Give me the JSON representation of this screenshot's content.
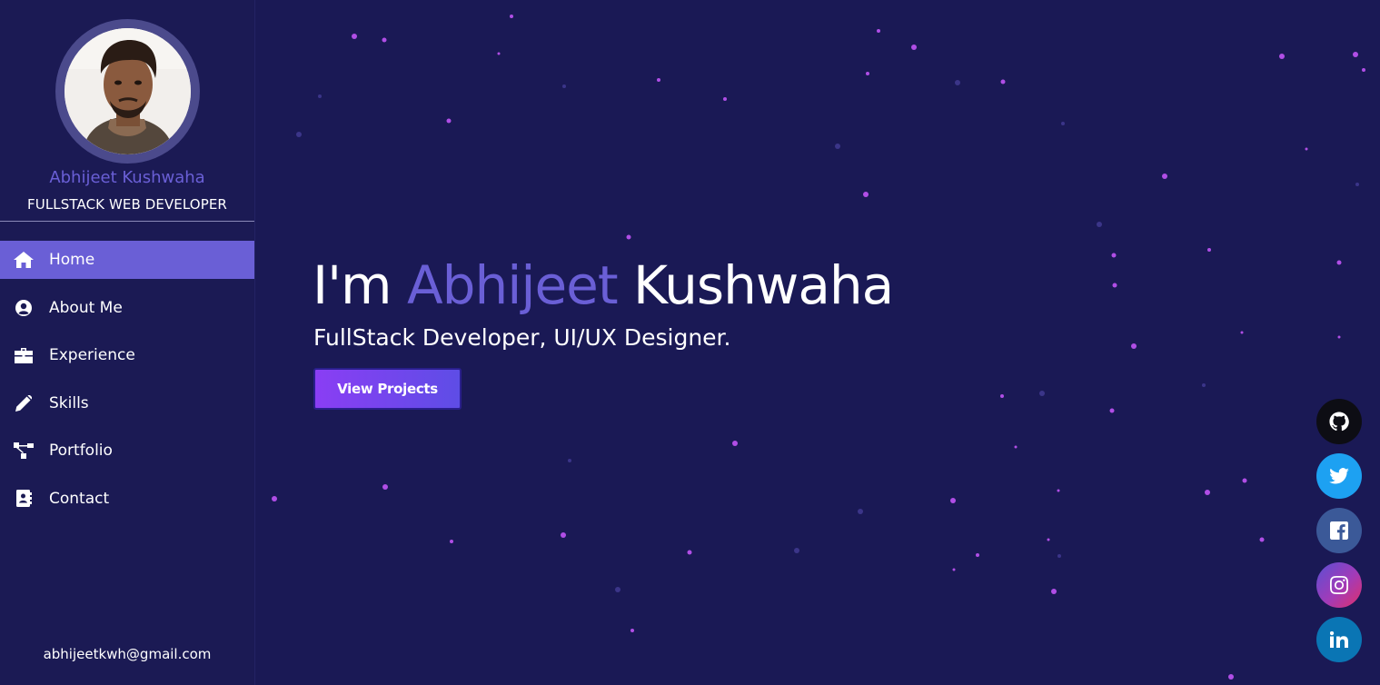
{
  "profile": {
    "name": "Abhijeet Kushwaha",
    "role": "FULLSTACK WEB DEVELOPER",
    "email": "abhijeetkwh@gmail.com"
  },
  "nav": {
    "items": [
      {
        "label": "Home",
        "icon": "home-icon",
        "active": true
      },
      {
        "label": "About Me",
        "icon": "user-circle-icon"
      },
      {
        "label": "Experience",
        "icon": "briefcase-icon"
      },
      {
        "label": "Skills",
        "icon": "pencil-icon"
      },
      {
        "label": "Portfolio",
        "icon": "sitemap-icon"
      },
      {
        "label": "Contact",
        "icon": "address-book-icon"
      }
    ]
  },
  "hero": {
    "prefix": "I'm",
    "first_name": "Abhijeet",
    "last_name": "Kushwaha",
    "subtitle": "FullStack Developer, UI/UX Designer.",
    "cta_label": "View Projects"
  },
  "social": [
    "github-icon",
    "twitter-icon",
    "facebook-icon",
    "instagram-icon",
    "linkedin-icon"
  ],
  "colors": {
    "background": "#1a1955",
    "accent": "#6a5fd6",
    "cta_start": "#8a3ef4",
    "cta_end": "#5e4de6",
    "particle": "#b04ee6"
  }
}
